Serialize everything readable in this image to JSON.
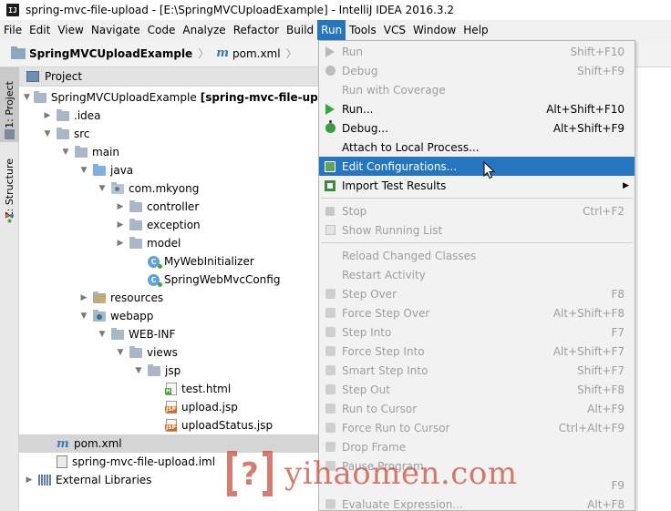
{
  "window": {
    "app_icon": "IJ",
    "title": "spring-mvc-file-upload - [E:\\SpringMVCUploadExample] - IntelliJ IDEA 2016.3.2"
  },
  "menubar": {
    "items": [
      "File",
      "Edit",
      "View",
      "Navigate",
      "Code",
      "Analyze",
      "Refactor",
      "Build",
      "Run",
      "Tools",
      "VCS",
      "Window",
      "Help"
    ],
    "active": "Run"
  },
  "breadcrumb": {
    "project": "SpringMVCUploadExample",
    "file": "pom.xml",
    "file_icon": "m"
  },
  "left_stripe": {
    "project_tab": "1: Project",
    "structure_tab": "Z: Structure"
  },
  "project_panel": {
    "title": "Project",
    "tree": [
      {
        "label": "SpringMVCUploadExample",
        "suffix": "[spring-mvc-file-upload]",
        "level": 0,
        "expanded": true,
        "icon": "folder-icon"
      },
      {
        "label": ".idea",
        "level": 1,
        "expanded": false,
        "icon": "folder-icon"
      },
      {
        "label": "src",
        "level": 1,
        "expanded": true,
        "icon": "folder-icon"
      },
      {
        "label": "main",
        "level": 2,
        "expanded": true,
        "icon": "folder-icon"
      },
      {
        "label": "java",
        "level": 3,
        "expanded": true,
        "icon": "source-folder-icon"
      },
      {
        "label": "com.mkyong",
        "level": 4,
        "expanded": true,
        "icon": "package-icon"
      },
      {
        "label": "controller",
        "level": 5,
        "expanded": false,
        "icon": "folder-icon"
      },
      {
        "label": "exception",
        "level": 5,
        "expanded": false,
        "icon": "folder-icon"
      },
      {
        "label": "model",
        "level": 5,
        "expanded": false,
        "icon": "folder-icon"
      },
      {
        "label": "MyWebInitializer",
        "level": 6,
        "icon": "class-icon"
      },
      {
        "label": "SpringWebMvcConfig",
        "level": 6,
        "icon": "class-icon"
      },
      {
        "label": "resources",
        "level": 3,
        "expanded": false,
        "icon": "resources-folder-icon"
      },
      {
        "label": "webapp",
        "level": 3,
        "expanded": true,
        "icon": "web-folder-icon"
      },
      {
        "label": "WEB-INF",
        "level": 4,
        "expanded": true,
        "icon": "folder-icon"
      },
      {
        "label": "views",
        "level": 5,
        "expanded": true,
        "icon": "folder-icon"
      },
      {
        "label": "jsp",
        "level": 6,
        "expanded": true,
        "icon": "folder-icon"
      },
      {
        "label": "test.html",
        "level": 7,
        "icon": "html-file-icon"
      },
      {
        "label": "upload.jsp",
        "level": 7,
        "icon": "jsp-file-icon"
      },
      {
        "label": "uploadStatus.jsp",
        "level": 7,
        "icon": "jsp-file-icon"
      },
      {
        "label": "pom.xml",
        "level": 1,
        "icon": "maven-icon",
        "selected": true
      },
      {
        "label": "spring-mvc-file-upload.iml",
        "level": 1,
        "icon": "iml-file-icon"
      },
      {
        "label": "External Libraries",
        "level": 0,
        "expanded": false,
        "icon": "libraries-icon"
      }
    ]
  },
  "run_menu": {
    "items": [
      {
        "label": "Run",
        "shortcut": "Shift+F10",
        "enabled": false,
        "icon": "run-icon"
      },
      {
        "label": "Debug",
        "shortcut": "Shift+F9",
        "enabled": false,
        "icon": "debug-icon"
      },
      {
        "label": "Run with Coverage",
        "shortcut": "",
        "enabled": false,
        "icon": ""
      },
      {
        "label": "Run...",
        "shortcut": "Alt+Shift+F10",
        "enabled": true,
        "icon": "run-icon"
      },
      {
        "label": "Debug...",
        "shortcut": "Alt+Shift+F9",
        "enabled": true,
        "icon": "debug-icon"
      },
      {
        "label": "Attach to Local Process...",
        "shortcut": "",
        "enabled": true,
        "icon": ""
      },
      {
        "label": "Edit Configurations...",
        "shortcut": "",
        "enabled": true,
        "highlighted": true,
        "icon": "edit-configurations-icon"
      },
      {
        "label": "Import Test Results",
        "shortcut": "",
        "enabled": true,
        "submenu": true,
        "icon": "import-icon"
      },
      {
        "separator": true
      },
      {
        "label": "Stop",
        "shortcut": "Ctrl+F2",
        "enabled": false,
        "icon": "stop-icon"
      },
      {
        "label": "Show Running List",
        "shortcut": "",
        "enabled": false,
        "icon": "list-icon"
      },
      {
        "separator": true
      },
      {
        "label": "Reload Changed Classes",
        "shortcut": "",
        "enabled": false,
        "icon": ""
      },
      {
        "label": "Restart Activity",
        "shortcut": "",
        "enabled": false,
        "icon": ""
      },
      {
        "label": "Step Over",
        "shortcut": "F8",
        "enabled": false,
        "icon": "step-over-icon"
      },
      {
        "label": "Force Step Over",
        "shortcut": "Alt+Shift+F8",
        "enabled": false,
        "icon": "force-step-over-icon"
      },
      {
        "label": "Step Into",
        "shortcut": "F7",
        "enabled": false,
        "icon": "step-into-icon"
      },
      {
        "label": "Force Step Into",
        "shortcut": "Alt+Shift+F7",
        "enabled": false,
        "icon": "force-step-into-icon"
      },
      {
        "label": "Smart Step Into",
        "shortcut": "Shift+F7",
        "enabled": false,
        "icon": "smart-step-into-icon"
      },
      {
        "label": "Step Out",
        "shortcut": "Shift+F8",
        "enabled": false,
        "icon": "step-out-icon"
      },
      {
        "label": "Run to Cursor",
        "shortcut": "Alt+F9",
        "enabled": false,
        "icon": "run-to-cursor-icon"
      },
      {
        "label": "Force Run to Cursor",
        "shortcut": "Ctrl+Alt+F9",
        "enabled": false,
        "icon": "force-run-to-cursor-icon"
      },
      {
        "label": "Drop Frame",
        "shortcut": "",
        "enabled": false,
        "icon": "drop-frame-icon"
      },
      {
        "label": "Pause Program",
        "shortcut": "",
        "enabled": false,
        "icon": "pause-icon"
      },
      {
        "label": "",
        "shortcut": "F9",
        "enabled": false,
        "icon": ""
      },
      {
        "label": "Evaluate Expression...",
        "shortcut": "Alt+F8",
        "enabled": false,
        "icon": "evaluate-icon"
      }
    ]
  },
  "watermark": {
    "text": "yihaomen.com",
    "logo_glyph": "?"
  },
  "colors": {
    "menu_highlight": "#2675bf",
    "disabled_text": "#9e9e9e",
    "tree_selection": "#d5d5d5",
    "watermark_red": "#c94a3a"
  }
}
